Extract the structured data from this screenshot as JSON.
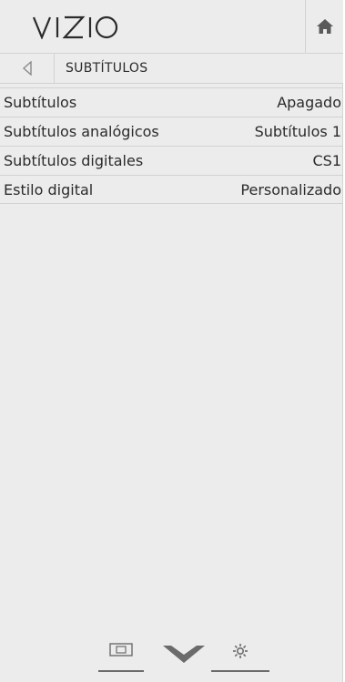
{
  "header": {
    "logo_text": "VIZIO",
    "home_icon": "home-icon"
  },
  "breadcrumb": {
    "back_icon": "back-arrow-icon",
    "title": "SUBTÍTULOS"
  },
  "menu": {
    "items": [
      {
        "label": "Subtítulos",
        "value": "Apagado"
      },
      {
        "label": "Subtítulos analógicos",
        "value": "Subtítulos 1"
      },
      {
        "label": "Subtítulos digitales",
        "value": "CS1"
      },
      {
        "label": "Estilo digital",
        "value": "Personalizado"
      }
    ]
  },
  "footer": {
    "icons": [
      "input-icon",
      "vizio-v-icon",
      "gear-icon"
    ]
  },
  "colors": {
    "panel_bg": "#ececec",
    "divider": "#d2d2d2",
    "text": "#2b2b2b",
    "icon": "#6b6b6b"
  }
}
